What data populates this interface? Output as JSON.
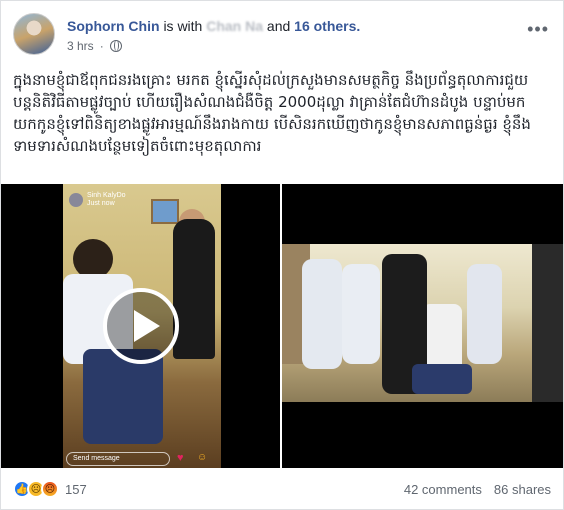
{
  "post": {
    "author": "Sophorn Chin",
    "with_text": "is with",
    "tagged_name": "Chan Na",
    "and_text": "and",
    "others": "16 others.",
    "time": "3 hrs",
    "privacy_icon": "globe-icon",
    "more_label": "•••",
    "body": "ក្នុងនាមខ្ញុំជាឪពុកជនរងគ្រោះ មរកត ខ្ញុំស្នើរសុំដល់ក្រសួងមានសមត្ថកិច្ច នឹងប្រព័ន្ធតុលាការជួយបន្តនិតិវិធីតាមផ្លូវច្បាប់ ហើយរឿងសំណងជំងឺចិត្ត 2000ដុល្លា វាគ្រាន់តែជំហ៊ានដំបូង បន្ទាប់មកយកកូនខ្ញុំទៅពិនិត្យខាងផ្លូវអារម្មណ៍នឹងរាងកាយ បើសិនរកឃើញថាកូនខ្ញុំមានសភាពធ្ងន់ធ្ងរ ខ្ញុំនឹងទាមទារសំណងបន្ថែមទៀតចំពោះមុខតុលាការ"
  },
  "media": {
    "video1": {
      "sender_name": "Sinh KalyDo",
      "sender_time": "Just now",
      "send_message_placeholder": "Send message",
      "heart_icon": "heart-icon",
      "emoji_icon": "smile-icon"
    },
    "video2": {}
  },
  "footer": {
    "reaction_icons": [
      "like-icon",
      "sad-icon",
      "angry-icon"
    ],
    "reaction_count": "157",
    "comments": "42 comments",
    "shares": "86 shares"
  },
  "colors": {
    "link": "#385898",
    "meta": "#606770",
    "like": "#2078f4"
  }
}
